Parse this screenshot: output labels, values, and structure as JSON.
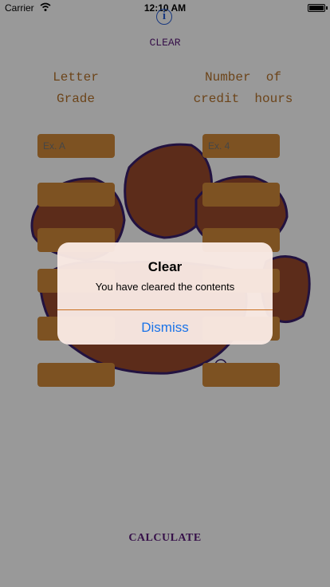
{
  "status_bar": {
    "carrier": "Carrier",
    "time": "12:10 AM"
  },
  "header": {
    "info_icon": "info-icon",
    "clear_label": "CLEAR"
  },
  "columns": {
    "letter_grade": [
      "Letter",
      "Grade"
    ],
    "credit_hours": [
      "Number  of",
      "credit  hours"
    ]
  },
  "rows": [
    {
      "grade_placeholder": "Ex. A",
      "hours_placeholder": "Ex. 4"
    },
    {
      "grade_placeholder": "",
      "hours_placeholder": ""
    },
    {
      "grade_placeholder": "",
      "hours_placeholder": ""
    },
    {
      "grade_placeholder": "",
      "hours_placeholder": ""
    },
    {
      "grade_placeholder": "",
      "hours_placeholder": ""
    },
    {
      "grade_placeholder": "",
      "hours_placeholder": ""
    }
  ],
  "footer": {
    "calculate_label": "CALCULATE"
  },
  "background": {
    "logo_icon": "tiger-paw-icon",
    "registered_mark": "®"
  },
  "alert": {
    "title": "Clear",
    "message": "You have cleared the contents",
    "dismiss_label": "Dismiss"
  },
  "colors": {
    "accent_orange": "#d1893a",
    "paw_fill": "#9a4a2c",
    "paw_outline": "#3a1f6b",
    "purple_text": "#5a1b7a",
    "button_blue": "#1a73e8"
  }
}
